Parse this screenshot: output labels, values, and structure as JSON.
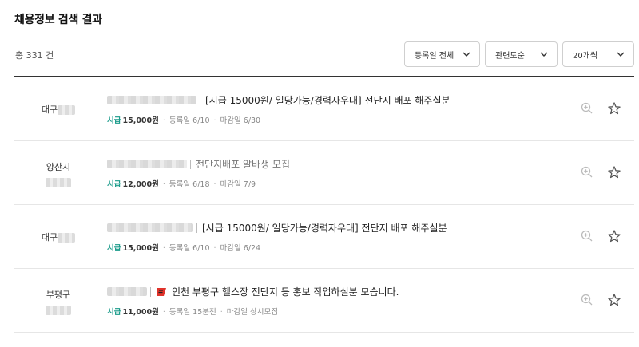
{
  "page": {
    "title": "채용정보 검색 결과",
    "total": "총 331 건"
  },
  "filters": [
    {
      "label": "등록일 전체"
    },
    {
      "label": "관련도순"
    },
    {
      "label": "20개씩"
    }
  ],
  "colors": {
    "wage_accent": "#1a9b8a",
    "flag_red": "#e0322a"
  },
  "listings": [
    {
      "location": "대구",
      "title": "[시급 15000원/ 일당가능/경력자우대] 전단지 배포 해주실분",
      "wage_label": "시급",
      "wage_amount": "15,000원",
      "registered": "등록일 6/10",
      "deadline": "마감일 6/30"
    },
    {
      "location": "양산시",
      "title": "전단지배포 알바생 모집",
      "wage_label": "시급",
      "wage_amount": "12,000원",
      "registered": "등록일 6/18",
      "deadline": "마감일 7/9"
    },
    {
      "location": "대구",
      "title": "[시급 15000원/ 일당가능/경력자우대] 전단지 배포 해주실분",
      "wage_label": "시급",
      "wage_amount": "15,000원",
      "registered": "등록일 6/10",
      "deadline": "마감일 6/24"
    },
    {
      "location": "부평구",
      "title": "인천 부평구 헬스장 전단지 등 홍보 작업하실분 모습니다.",
      "wage_label": "시급",
      "wage_amount": "11,000원",
      "registered": "등록일 15분전",
      "deadline": "마감일 상시모집"
    }
  ]
}
